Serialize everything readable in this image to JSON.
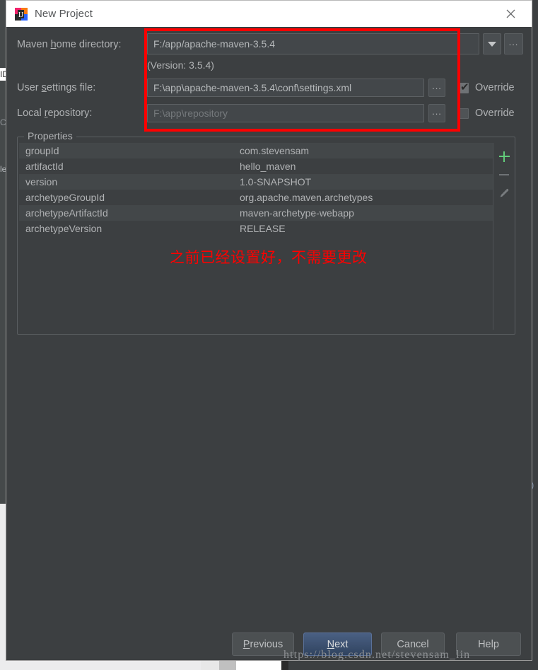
{
  "window": {
    "title": "New Project",
    "app_icon": "intellij-idea-icon",
    "close_icon": "close-icon"
  },
  "form": {
    "maven_home": {
      "label_pre": "Maven ",
      "label_mnemonic": "h",
      "label_post": "ome directory:",
      "value": "F:/app/apache-maven-3.5.4",
      "dropdown_icon": "chevron-down-icon",
      "browse_label": "...",
      "version_note": "(Version: 3.5.4)"
    },
    "user_settings": {
      "label_pre": "User ",
      "label_mnemonic": "s",
      "label_post": "ettings file:",
      "value": "F:\\app\\apache-maven-3.5.4\\conf\\settings.xml",
      "browse_label": "...",
      "override_label": "Override",
      "override_checked": true
    },
    "local_repository": {
      "label_pre": "Local ",
      "label_mnemonic": "r",
      "label_post": "epository:",
      "value": "F:\\app\\repository",
      "browse_label": "...",
      "override_label": "Override",
      "override_checked": false
    }
  },
  "properties": {
    "legend": "Properties",
    "rows": [
      {
        "key": "groupId",
        "value": "com.stevensam"
      },
      {
        "key": "artifactId",
        "value": "hello_maven"
      },
      {
        "key": "version",
        "value": "1.0-SNAPSHOT"
      },
      {
        "key": "archetypeGroupId",
        "value": "org.apache.maven.archetypes"
      },
      {
        "key": "archetypeArtifactId",
        "value": "maven-archetype-webapp"
      },
      {
        "key": "archetypeVersion",
        "value": "RELEASE"
      }
    ],
    "toolbar": {
      "add_icon": "plus-icon",
      "remove_icon": "minus-icon",
      "edit_icon": "pencil-icon"
    }
  },
  "annotation": {
    "note_text": "之前已经设置好，不需要更改",
    "note_color": "#fe0000",
    "box_color": "#fe0000"
  },
  "buttons": {
    "previous": {
      "label_pre": "",
      "label_mnemonic": "P",
      "label_post": "revious"
    },
    "next": {
      "label_pre": "",
      "label_mnemonic": "N",
      "label_post": "ext"
    },
    "cancel": {
      "label": "Cancel"
    },
    "help": {
      "label": "Help"
    }
  },
  "background": {
    "ghost_id": "ID",
    "ghost_c": "C",
    "ghost_le": "le",
    "ghost_paren": ")"
  },
  "watermark": "https://blog.csdn.net/stevensam_lin",
  "colors": {
    "dialog_bg": "#3c3f41",
    "field_bg": "#43474a",
    "text": "#b0b2b4",
    "accent_red": "#fe0000",
    "accent_green": "#62cb7a",
    "next_blue": "#4a6083"
  }
}
